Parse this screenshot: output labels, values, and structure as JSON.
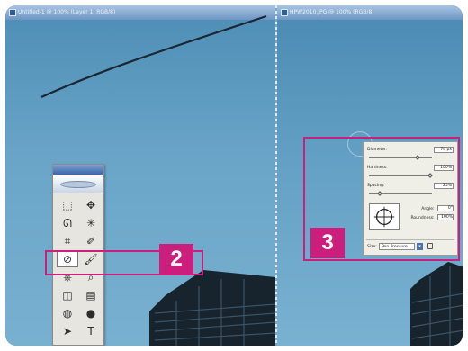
{
  "windows": [
    {
      "title": "Untitled-1 @ 100% (Layer 1, RGB/8)"
    },
    {
      "title": "HPW2010.JPG @ 100% (RGB/8)"
    }
  ],
  "toolbox": {
    "tools": [
      {
        "name": "marquee-tool",
        "glyph": "⬚"
      },
      {
        "name": "move-tool",
        "glyph": "✥"
      },
      {
        "name": "lasso-tool",
        "glyph": "ᘏ"
      },
      {
        "name": "magic-wand-tool",
        "glyph": "✳"
      },
      {
        "name": "crop-tool",
        "glyph": "⌗"
      },
      {
        "name": "slice-tool",
        "glyph": "✐"
      },
      {
        "name": "healing-brush-tool",
        "glyph": "⊘"
      },
      {
        "name": "brush-tool",
        "glyph": "🖌"
      },
      {
        "name": "clone-stamp-tool",
        "glyph": "⎈"
      },
      {
        "name": "history-brush-tool",
        "glyph": "⌕"
      },
      {
        "name": "eraser-tool",
        "glyph": "◫"
      },
      {
        "name": "gradient-tool",
        "glyph": "▤"
      },
      {
        "name": "blur-tool",
        "glyph": "◍"
      },
      {
        "name": "dodge-tool",
        "glyph": "●"
      },
      {
        "name": "path-selection-tool",
        "glyph": "➤"
      },
      {
        "name": "type-tool",
        "glyph": "T"
      }
    ],
    "selected_index": 6
  },
  "callouts": {
    "brush_step": "2",
    "options_step": "3"
  },
  "brush_options": {
    "diameter_label": "Diameter:",
    "diameter_value": "74 px",
    "hardness_label": "Hardness:",
    "hardness_value": "100%",
    "spacing_label": "Spacing:",
    "spacing_value": "25%",
    "angle_label": "Angle:",
    "angle_value": "0°",
    "roundness_label": "Roundness:",
    "roundness_value": "100%",
    "size_label": "Size:",
    "size_value": "Pen Pressure"
  },
  "colors": {
    "accent": "#cc1f7d",
    "sky": "#5b98bd"
  }
}
